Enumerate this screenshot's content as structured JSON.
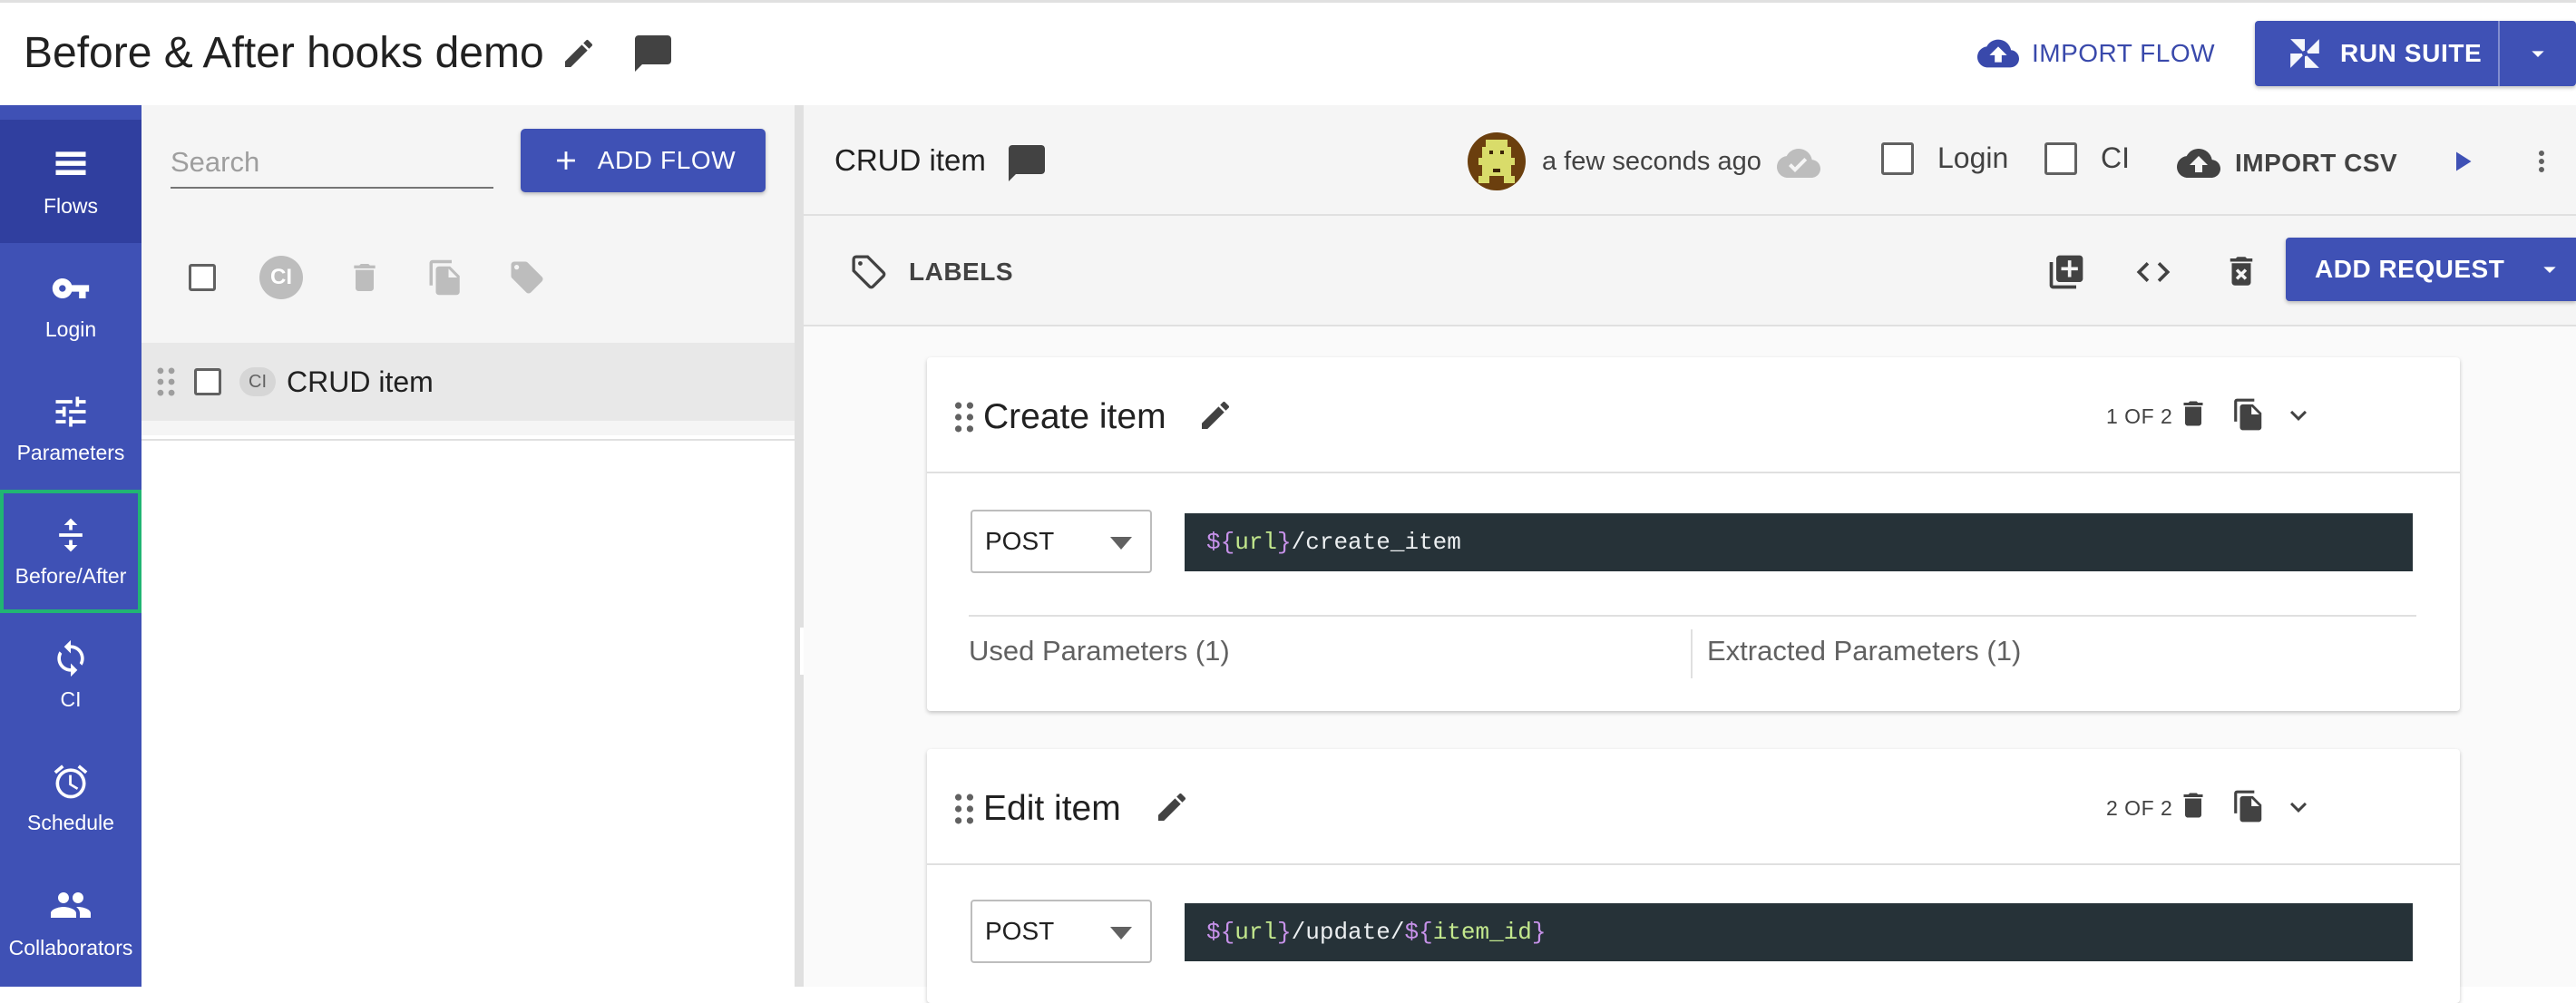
{
  "suite": {
    "title": "Before & After hooks demo"
  },
  "header": {
    "import_flow": "IMPORT FLOW",
    "run_suite": "RUN SUITE"
  },
  "nav": {
    "items": [
      {
        "label": "Flows",
        "icon": "list-icon"
      },
      {
        "label": "Login",
        "icon": "key-icon"
      },
      {
        "label": "Parameters",
        "icon": "tune-icon"
      },
      {
        "label": "Before/After",
        "icon": "vertical-split-icon"
      },
      {
        "label": "CI",
        "icon": "sync-icon"
      },
      {
        "label": "Schedule",
        "icon": "alarm-icon"
      },
      {
        "label": "Collaborators",
        "icon": "people-icon"
      }
    ]
  },
  "flows": {
    "search_placeholder": "Search",
    "add_flow": "ADD FLOW",
    "ci_badge": "CI",
    "list": [
      {
        "name": "CRUD item",
        "chip": "CI"
      }
    ]
  },
  "flow": {
    "title": "CRUD item",
    "updated": "a few seconds ago",
    "login_label": "Login",
    "ci_label": "CI",
    "import_csv": "IMPORT CSV",
    "labels_button": "LABELS",
    "add_request": "ADD REQUEST"
  },
  "requests": [
    {
      "title": "Create item",
      "count": "1 OF 2",
      "method": "POST",
      "url": {
        "pre": "${",
        "var": "url",
        "post": "}",
        "path": "/create_item"
      },
      "used_params": "Used Parameters (1)",
      "extracted_params": "Extracted Parameters (1)"
    },
    {
      "title": "Edit item",
      "count": "2 OF 2",
      "method": "POST",
      "url": {
        "pre": "${",
        "var": "url",
        "post": "}",
        "path": "/update/",
        "pre2": "${",
        "var2": "item_id",
        "post2": "}"
      }
    }
  ],
  "colors": {
    "primary": "#3f51b5",
    "active_outline": "#21b573",
    "code_bg": "#263238"
  }
}
